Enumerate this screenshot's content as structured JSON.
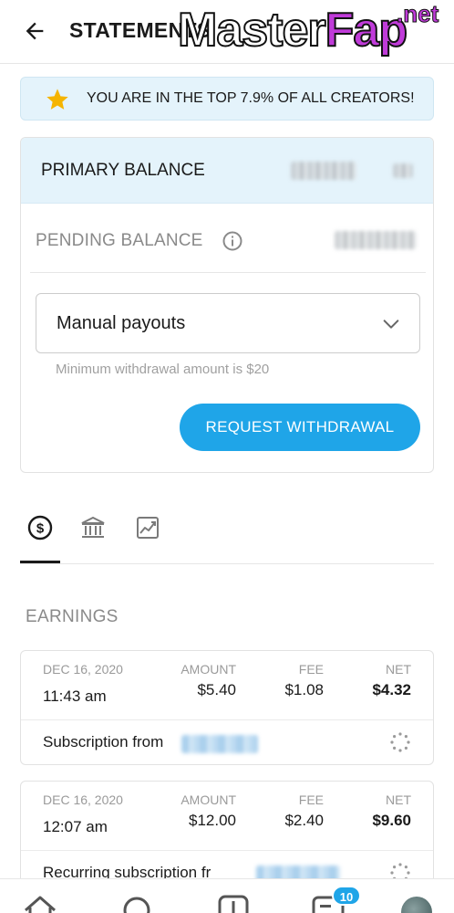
{
  "header": {
    "title": "STATEMENTS",
    "back_icon": "arrow-left-icon"
  },
  "watermark": {
    "master": "Master",
    "fap": "Fap",
    "net": ".net"
  },
  "banner": {
    "text": "YOU ARE IN THE TOP 7.9% OF ALL CREATORS!",
    "icon": "star-icon",
    "star_color": "#f5b400"
  },
  "balance": {
    "primary_label": "PRIMARY BALANCE",
    "pending_label": "PENDING BALANCE",
    "payout_value": "Manual payouts",
    "min_withdraw_text": "Minimum withdrawal amount is $20",
    "withdraw_button": "REQUEST WITHDRAWAL"
  },
  "tabs": [
    {
      "icon": "dollar-circle-icon",
      "active": true
    },
    {
      "icon": "bank-icon",
      "active": false
    },
    {
      "icon": "chart-icon",
      "active": false
    }
  ],
  "earnings": {
    "title": "EARNINGS",
    "columns": {
      "amount": "AMOUNT",
      "fee": "FEE",
      "net": "NET"
    },
    "rows": [
      {
        "date": "DEC 16, 2020",
        "time": "11:43 am",
        "amount": "$5.40",
        "fee": "$1.08",
        "net": "$4.32",
        "description": "Subscription from"
      },
      {
        "date": "DEC 16, 2020",
        "time": "12:07 am",
        "amount": "$12.00",
        "fee": "$2.40",
        "net": "$9.60",
        "description": "Recurring subscription fr"
      }
    ]
  },
  "bottom_nav": {
    "badge": "10"
  },
  "colors": {
    "accent": "#1fa5e8",
    "banner_bg": "#e4f3fb"
  }
}
